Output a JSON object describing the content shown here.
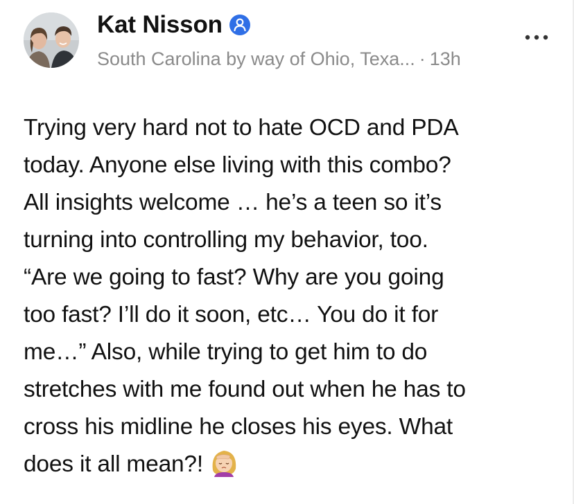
{
  "post": {
    "author": {
      "name": "Kat Nisson",
      "verified_icon": "verified-badge-icon",
      "badge_color": "#2f6fe6",
      "location": "South Carolina by way of Ohio, Texa...",
      "separator": "·",
      "time_ago": "13h"
    },
    "more_icon": "ellipsis-icon",
    "body_text": "Trying very hard not to hate OCD and PDA\ntoday. Anyone else living with this combo?\nAll insights welcome … he’s a teen so it’s\nturning into controlling my behavior, too.\n“Are we going to fast? Why are you going\ntoo fast? I’ll do it soon, etc… You do it for\nme…” Also, while trying to get him to do\nstretches with me found out when he has to\ncross his midline he closes his eyes. What\ndoes it all mean?!",
    "emoji": "face-palm-emoji-icon"
  }
}
